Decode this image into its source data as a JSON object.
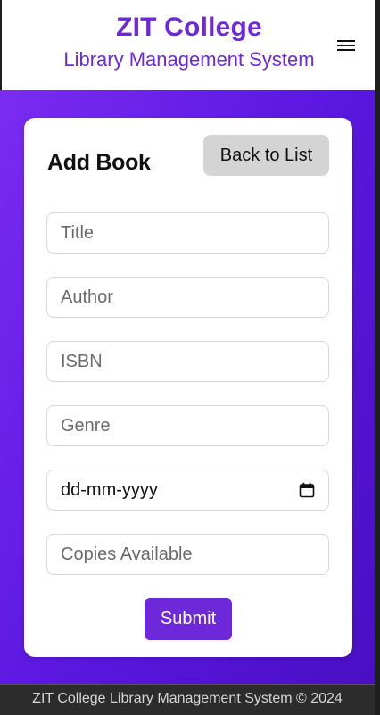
{
  "header": {
    "title": "ZIT College",
    "subtitle": "Library Management System",
    "menu_icon": "hamburger-menu-icon"
  },
  "colors": {
    "brand": "#6d28d9",
    "gradient_start": "#7a2cf2",
    "gradient_end": "#4a0fc4",
    "secondary_button": "#d4d4d4",
    "footer": "#2c2c2c"
  },
  "form": {
    "heading": "Add Book",
    "back_label": "Back to List",
    "fields": {
      "title": {
        "placeholder": "Title",
        "value": ""
      },
      "author": {
        "placeholder": "Author",
        "value": ""
      },
      "isbn": {
        "placeholder": "ISBN",
        "value": ""
      },
      "genre": {
        "placeholder": "Genre",
        "value": ""
      },
      "date": {
        "display": "dd-mm-yyyy",
        "icon": "calendar-icon"
      },
      "copies": {
        "placeholder": "Copies Available",
        "value": ""
      }
    },
    "submit_label": "Submit"
  },
  "footer": {
    "text": "ZIT College Library Management System © 2024"
  }
}
